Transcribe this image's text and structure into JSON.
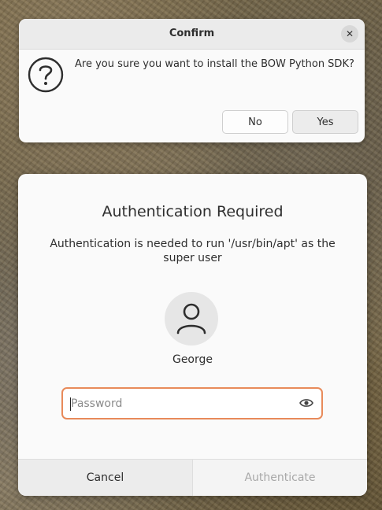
{
  "confirm": {
    "title": "Confirm",
    "close_icon": "close-icon",
    "question_icon": "question-icon",
    "message": "Are you sure you want to install the BOW Python SDK?",
    "no_label": "No",
    "yes_label": "Yes"
  },
  "auth": {
    "title": "Authentication Required",
    "message": "Authentication is needed to run '/usr/bin/apt' as the super user",
    "avatar_icon": "user-icon",
    "username": "George",
    "password": {
      "placeholder": "Password",
      "value": ""
    },
    "reveal_icon": "eye-icon",
    "cancel_label": "Cancel",
    "authenticate_label": "Authenticate",
    "colors": {
      "focus_border": "#e88a5a",
      "disabled_text": "#a8a8a8"
    }
  }
}
